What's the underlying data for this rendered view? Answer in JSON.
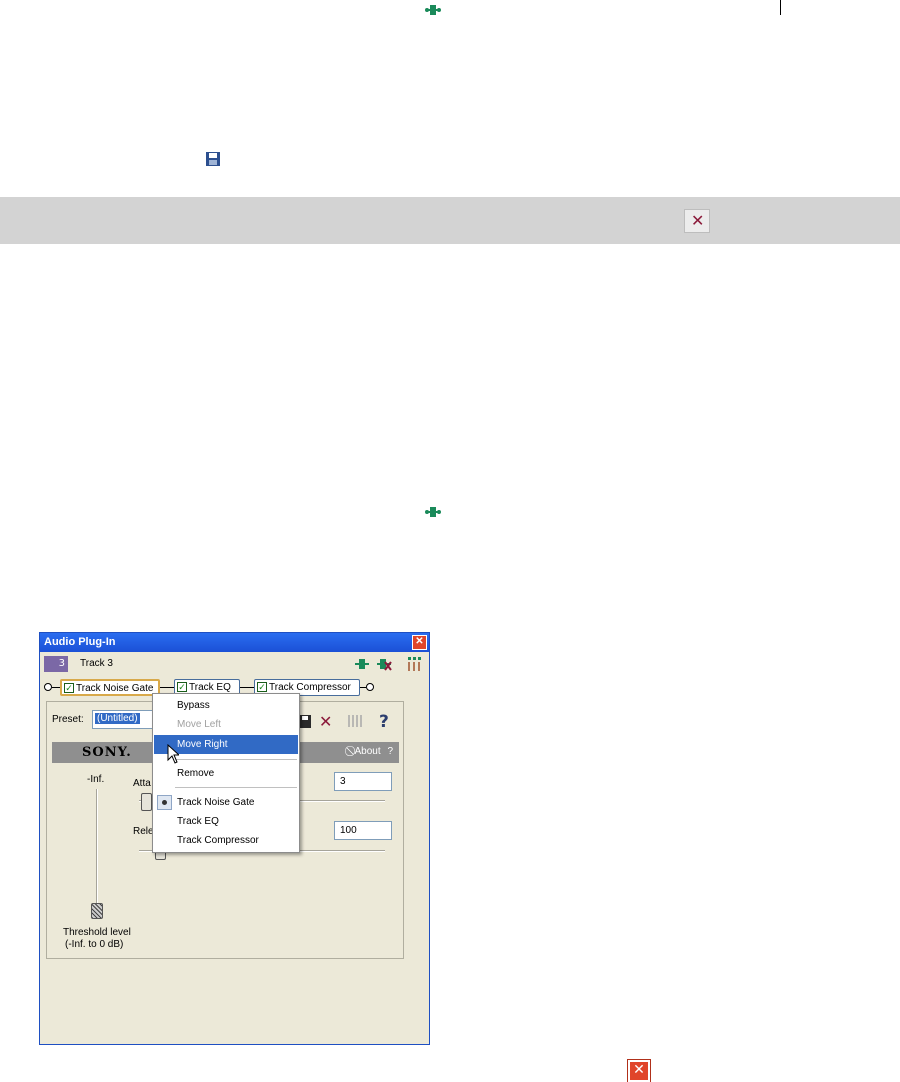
{
  "window": {
    "title": "Audio Plug-In",
    "track_number": "3",
    "track_name": "Track 3",
    "chain": [
      "Track Noise Gate",
      "Track EQ",
      "Track Compressor"
    ]
  },
  "preset": {
    "label": "Preset:",
    "value": "(Untitled)"
  },
  "brand_bar": {
    "brand": "SONY.",
    "about": "About",
    "help": "?"
  },
  "controls": {
    "level_top": "-Inf.",
    "attack_label": "Atta",
    "attack_value": "3",
    "release_label": "Rele",
    "release_value": "100",
    "threshold_label": "Threshold level",
    "threshold_range": "(-Inf. to 0 dB)"
  },
  "context_menu": {
    "items": [
      "Bypass",
      "Move Left",
      "Move Right",
      "Remove",
      "Track Noise Gate",
      "Track EQ",
      "Track Compressor"
    ]
  },
  "colors": {
    "title_bar": "#1b50d6",
    "highlight": "#316ac5",
    "close_red": "#e0452a",
    "track_swatch": "#7b68a6"
  }
}
